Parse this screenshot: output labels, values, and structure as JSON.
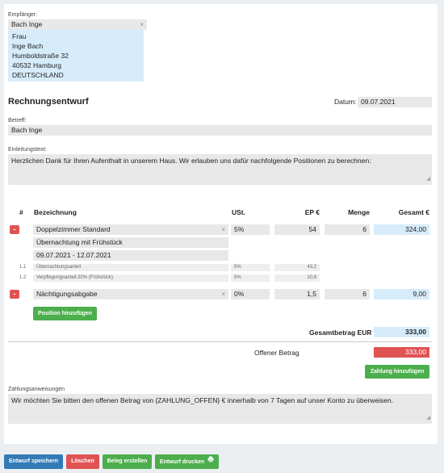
{
  "recipient": {
    "label": "Empfänger:",
    "value": "Bach Inge",
    "clear": "×",
    "address": [
      "Frau",
      "Inge Bach",
      "Humboldstraße 32",
      "40532 Hamburg",
      "DEUTSCHLAND"
    ]
  },
  "title": "Rechnungsentwurf",
  "date": {
    "label": "Datum:",
    "value": "09.07.2021"
  },
  "subject": {
    "label": "Betreff:",
    "value": "Bach Inge"
  },
  "intro": {
    "label": "Einleitungstext:",
    "value": "Herzlichen Dank für Ihren Aufenthalt in unserem Haus. Wir erlauben uns dafür nachfolgende Positionen zu berechnen:"
  },
  "table": {
    "headers": {
      "num": "#",
      "desc": "Bezeichnung",
      "vat": "USt.",
      "unit_price": "EP €",
      "qty": "Menge",
      "total": "Gesamt €"
    },
    "pos1": {
      "delete": "-",
      "name": "Doppelzimmer Standard",
      "clear": "×",
      "vat": "5%",
      "unit_price": "54",
      "qty": "6",
      "total": "324,00",
      "detail1": "Übernachtung mit Frühstück",
      "detail2": "09.07.2021 - 12.07.2021",
      "sub": [
        {
          "idx": "1.1",
          "name": "Übernachtungsanteil",
          "vat": "5%",
          "price": "43,2"
        },
        {
          "idx": "1.2",
          "name": "Verpflegungsanteil 20% (Frühstück)",
          "vat": "5%",
          "price": "10,8"
        }
      ]
    },
    "pos2": {
      "delete": "-",
      "name": "Nächtigungsabgabe",
      "clear": "×",
      "vat": "0%",
      "unit_price": "1,5",
      "qty": "6",
      "total": "9,00"
    },
    "add_position": "Position hinzufügen"
  },
  "totals": {
    "total_label": "Gesamtbetrag EUR",
    "total_value": "333,00",
    "open_label": "Offener Betrag",
    "open_value": "333,00"
  },
  "payment": {
    "add_button": "Zahlung hinzufügen",
    "label": "Zahlungsanweisungen",
    "value": "Wir möchten Sie bitten den offenen Betrag von {ZAHLUNG_OFFEN} € innerhalb von 7 Tagen auf unser Konto zu überweisen."
  },
  "actions": {
    "save": "Entwurf speichern",
    "delete": "Löschen",
    "create": "Beleg erstellen",
    "print": "Entwurf drucken"
  },
  "icons": {
    "print": "printer-icon",
    "resize": "resize-handle-icon"
  },
  "colors": {
    "primary": "#337ab7",
    "danger": "#e05353",
    "success": "#4cae4c",
    "highlight": "#d7ecfa"
  }
}
